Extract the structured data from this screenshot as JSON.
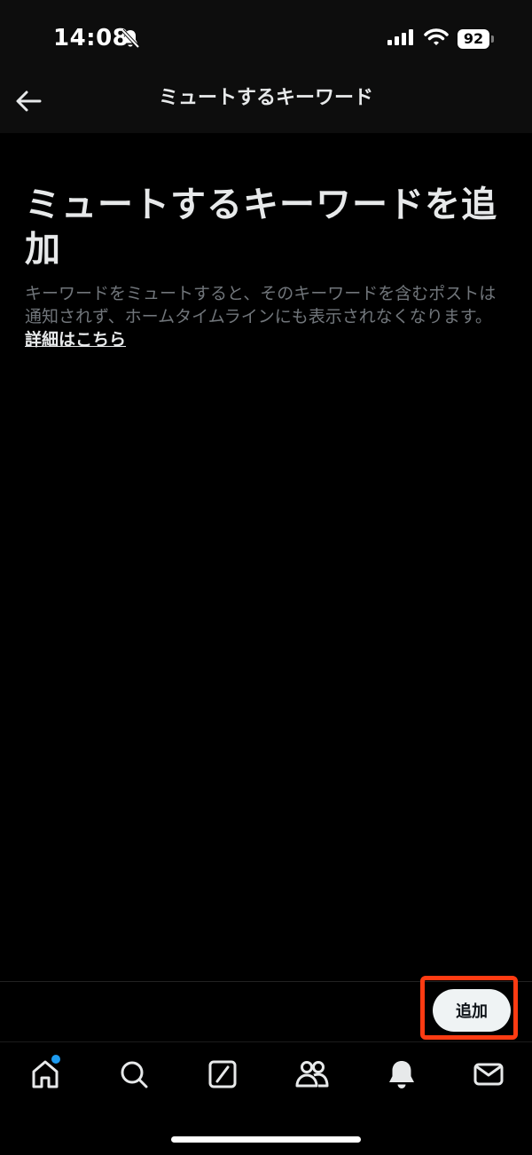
{
  "status_bar": {
    "time": "14:08",
    "battery": "92",
    "icons": [
      "bell-off-icon",
      "signal-icon",
      "wifi-icon",
      "battery-icon"
    ]
  },
  "nav": {
    "title": "ミュートするキーワード",
    "back_icon": "arrow-left-icon"
  },
  "content": {
    "heading": "ミュートするキーワードを追加",
    "description": "キーワードをミュートすると、そのキーワードを含むポストは通知されず、ホームタイムラインにも表示されなくなります。",
    "learn_more": "詳細はこちら"
  },
  "actions": {
    "add_label": "追加",
    "highlight_color": "#ff3b12"
  },
  "tabs": [
    {
      "name": "home",
      "icon": "home-icon",
      "has_badge": true
    },
    {
      "name": "search",
      "icon": "search-icon"
    },
    {
      "name": "grok",
      "icon": "grok-icon"
    },
    {
      "name": "communities",
      "icon": "people-icon"
    },
    {
      "name": "notifications",
      "icon": "bell-icon"
    },
    {
      "name": "messages",
      "icon": "mail-icon"
    }
  ],
  "colors": {
    "background": "#000000",
    "text_primary": "#e7e9ea",
    "text_secondary": "#71767b",
    "accent": "#1d9bf0"
  }
}
